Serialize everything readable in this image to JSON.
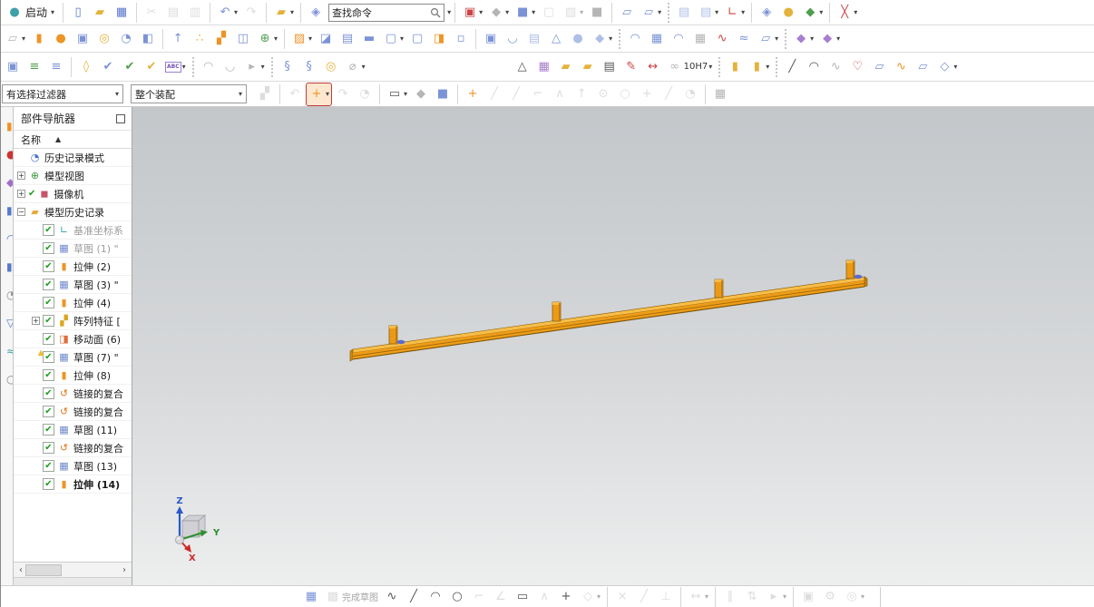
{
  "menubar": {
    "start_label": "启动",
    "caret": "▾"
  },
  "search": {
    "value": "查找命令"
  },
  "selection_bar": {
    "filter_value": "有选择过滤器",
    "scope_value": "整个装配"
  },
  "navigator": {
    "title": "部件导航器",
    "name_header": "名称",
    "sort_icon": "▲",
    "items": [
      {
        "label": "历史记录模式",
        "icon": "clock"
      },
      {
        "label": "模型视图",
        "icon": "views",
        "exp": "+"
      },
      {
        "label": "摄像机",
        "icon": "camera",
        "exp": "+",
        "pre": true
      },
      {
        "label": "模型历史记录",
        "icon": "folder",
        "exp": "-"
      },
      {
        "label": "基准坐标系",
        "icon": "csys",
        "check": true,
        "gray": true
      },
      {
        "label": "草图 (1) \"",
        "icon": "sketch",
        "check": true,
        "gray": true
      },
      {
        "label": "拉伸 (2)",
        "icon": "extrude",
        "check": true
      },
      {
        "label": "草图 (3) \"",
        "icon": "sketch",
        "check": true
      },
      {
        "label": "拉伸 (4)",
        "icon": "extrude",
        "check": true
      },
      {
        "label": "阵列特征 [",
        "icon": "pattern",
        "check": true,
        "exp": "+"
      },
      {
        "label": "移动面 (6)",
        "icon": "moveface",
        "check": true
      },
      {
        "label": "草图 (7) \"",
        "icon": "sketch",
        "check": true,
        "warn": true
      },
      {
        "label": "拉伸 (8)",
        "icon": "extrude",
        "check": true
      },
      {
        "label": "链接的复合",
        "icon": "linked",
        "check": true
      },
      {
        "label": "链接的复合",
        "icon": "linked",
        "check": true
      },
      {
        "label": "草图 (11)",
        "icon": "sketch",
        "check": true
      },
      {
        "label": "链接的复合",
        "icon": "linked",
        "check": true
      },
      {
        "label": "草图 (13)",
        "icon": "sketch",
        "check": true
      },
      {
        "label": "拉伸 (14)",
        "icon": "extrude",
        "check": true,
        "bold": true
      }
    ],
    "scroll_left": "‹",
    "scroll_right": "›"
  },
  "viewport": {
    "axis_x": "X",
    "axis_y": "Y",
    "axis_z": "Z",
    "model_color": "#ee9c18",
    "model_top_color": "#f8be49",
    "model_edge_color": "#7a5408"
  },
  "toolbar_row1a": [
    {
      "sep": 1
    },
    {
      "n": "new-file-button",
      "g": "▯",
      "c": "c-save"
    },
    {
      "n": "open-button",
      "g": "▰",
      "c": "c-gold"
    },
    {
      "n": "save-button",
      "g": "▦",
      "c": "c-save"
    },
    {
      "sep": 1
    },
    {
      "n": "cut-button",
      "g": "✂",
      "c": "c-gray",
      "dis": 1
    },
    {
      "n": "copy-button",
      "g": "▤",
      "c": "c-gray",
      "dis": 1
    },
    {
      "n": "paste-button",
      "g": "▥",
      "c": "c-gray",
      "dis": 1
    },
    {
      "sep": 1
    },
    {
      "n": "undo-button",
      "g": "↶",
      "c": "c-blue",
      "cap": 1
    },
    {
      "n": "redo-button",
      "g": "↷",
      "c": "c-gray",
      "dis": 1
    },
    {
      "sep": 1
    },
    {
      "n": "reopen-part-button",
      "g": "▰",
      "c": "c-gold",
      "cap": 1
    },
    {
      "sep": 1
    },
    {
      "n": "command-help-button",
      "g": "◈",
      "c": "c-blue"
    }
  ],
  "toolbar_row1b": [
    {
      "sep": 1
    },
    {
      "n": "fit-view-button",
      "g": "▣",
      "c": "c-red",
      "cap": 1
    },
    {
      "n": "render-style-button",
      "g": "◆",
      "c": "c-gray",
      "cap": 1
    },
    {
      "n": "orient-view-button",
      "g": "■",
      "c": "c-blue",
      "cap": 1
    },
    {
      "n": "section-view-button",
      "g": "▢",
      "c": "c-gray",
      "dis": 1
    },
    {
      "n": "drafting-view-button",
      "g": "▧",
      "c": "c-gray",
      "dis": 1,
      "cap": 1
    },
    {
      "n": "window-style-button",
      "g": "■",
      "c": "c-gray"
    },
    {
      "sep": 1
    },
    {
      "n": "new-window-button",
      "g": "▱",
      "c": "c-blue"
    },
    {
      "n": "cascade-windows-button",
      "g": "▱",
      "c": "c-blue",
      "cap": 1
    },
    {
      "sep": 1,
      "dot": 1
    },
    {
      "n": "part-navigator-list-button",
      "g": "▤",
      "c": "c-lblue"
    },
    {
      "n": "assembly-navigator-list-button",
      "g": "▤",
      "c": "c-lblue",
      "cap": 1
    },
    {
      "n": "wcs-dynamics-button",
      "g": "∟",
      "c": "c-red",
      "cap": 1
    },
    {
      "sep": 1
    },
    {
      "n": "help-library-button",
      "g": "◈",
      "c": "c-blue"
    },
    {
      "n": "touch-mode-button",
      "g": "●",
      "c": "c-gold"
    },
    {
      "n": "visual-reporting-button",
      "g": "◆",
      "c": "c-green",
      "cap": 1
    },
    {
      "sep": 1
    },
    {
      "n": "no-selection-filter-button",
      "g": "╳",
      "c": "c-red",
      "cap": 1
    }
  ],
  "toolbar_row2": [
    {
      "n": "sheet-operations-button",
      "g": "▱",
      "c": "c-gray",
      "cap": 1
    },
    {
      "n": "extrude-button",
      "g": "▮",
      "c": "c-orange"
    },
    {
      "n": "revolve-button",
      "g": "●",
      "c": "c-orange"
    },
    {
      "n": "hole-button",
      "g": "▣",
      "c": "c-blue"
    },
    {
      "n": "boss-button",
      "g": "◎",
      "c": "c-gold"
    },
    {
      "n": "pocket-button",
      "g": "◔",
      "c": "c-blue"
    },
    {
      "n": "pad-button",
      "g": "◧",
      "c": "c-blue"
    },
    {
      "sep": 1
    },
    {
      "n": "emboss-button",
      "g": "↑",
      "c": "c-blue"
    },
    {
      "n": "offset-face-button",
      "g": "∴",
      "c": "c-gold"
    },
    {
      "n": "pattern-feature-button",
      "g": "▞",
      "c": "c-orange"
    },
    {
      "n": "mirror-feature-button",
      "g": "◫",
      "c": "c-blue"
    },
    {
      "n": "unite-button",
      "g": "⊕",
      "c": "c-green",
      "cap": 1
    },
    {
      "sep": 1
    },
    {
      "n": "trim-body-button",
      "g": "▨",
      "c": "c-orange",
      "cap": 1
    },
    {
      "n": "subtract-button",
      "g": "◪",
      "c": "c-blue"
    },
    {
      "n": "delete-face-button",
      "g": "▤",
      "c": "c-blue"
    },
    {
      "n": "trim-sheet-button",
      "g": "▬",
      "c": "c-blue"
    },
    {
      "n": "split-body-button",
      "g": "▢",
      "c": "c-blue",
      "cap": 1
    },
    {
      "n": "cavity-button",
      "g": "▢",
      "c": "c-blue"
    },
    {
      "n": "thicken-button",
      "g": "◨",
      "c": "c-orange"
    },
    {
      "n": "scale-body-button",
      "g": "▫",
      "c": "c-blue"
    },
    {
      "sep": 1
    },
    {
      "n": "shell-button",
      "g": "▣",
      "c": "c-blue"
    },
    {
      "n": "bend-button",
      "g": "◡",
      "c": "c-blue"
    },
    {
      "n": "law-extension-button",
      "g": "▤",
      "c": "c-lblue"
    },
    {
      "n": "draft-button",
      "g": "△",
      "c": "c-blue"
    },
    {
      "n": "edge-blend-button",
      "g": "●",
      "c": "c-lblue"
    },
    {
      "n": "chamfer-button",
      "g": "◆",
      "c": "c-lblue",
      "cap": 1
    },
    {
      "sep": 1,
      "dot": 1
    },
    {
      "n": "ruled-surface-button",
      "g": "◠",
      "c": "c-blue"
    },
    {
      "n": "through-curves-button",
      "g": "▦",
      "c": "c-blue"
    },
    {
      "n": "swept-button",
      "g": "◠",
      "c": "c-blue"
    },
    {
      "n": "mesh-surface-button",
      "g": "▦",
      "c": "c-gray"
    },
    {
      "n": "studio-surface-button",
      "g": "∿",
      "c": "c-red"
    },
    {
      "n": "through-curve-mesh-button",
      "g": "≈",
      "c": "c-blue"
    },
    {
      "n": "emboss-sheet-button",
      "g": "▱",
      "c": "c-blue",
      "cap": 1
    },
    {
      "sep": 1,
      "dot": 1
    },
    {
      "n": "move-object-button",
      "g": "◆",
      "c": "c-purple",
      "cap": 1
    },
    {
      "n": "deform-body-button",
      "g": "◆",
      "c": "c-purple",
      "cap": 1
    }
  ],
  "toolbar_row3": [
    {
      "n": "spline-frame-button",
      "g": "▣",
      "c": "c-blue"
    },
    {
      "n": "layer-settings-button",
      "g": "≡",
      "c": "c-green"
    },
    {
      "n": "layer-visibility-button",
      "g": "≡",
      "c": "c-blue"
    },
    {
      "sep": 1
    },
    {
      "n": "annotation-tag-button",
      "g": "◊",
      "c": "c-gold"
    },
    {
      "n": "replay-feature-button",
      "g": "✔",
      "c": "c-blue"
    },
    {
      "n": "examine-geometry-button",
      "g": "✔",
      "c": "c-green"
    },
    {
      "n": "feature-check-button",
      "g": "✔",
      "c": "c-gold"
    },
    {
      "n": "text-button",
      "g": "ABC",
      "c": "c-abc",
      "cap": 1
    },
    {
      "sep": 1,
      "dot": 1
    },
    {
      "n": "unsew-button",
      "g": "◠",
      "c": "c-gray"
    },
    {
      "n": "unsew-alt-button",
      "g": "◡",
      "c": "c-gray"
    },
    {
      "n": "selection-priority-button",
      "g": "▸",
      "c": "c-gray",
      "cap": 1
    },
    {
      "sep": 1,
      "dot": 1
    },
    {
      "n": "coil-button",
      "g": "§",
      "c": "c-blue"
    },
    {
      "n": "spring-button",
      "g": "§",
      "c": "c-blue"
    },
    {
      "n": "washer-button",
      "g": "◎",
      "c": "c-gold"
    },
    {
      "n": "suppress-spring-button",
      "g": "⌀",
      "c": "c-gray",
      "cap": 1
    },
    {
      "sep": 1,
      "gap": 1
    },
    {
      "n": "triangle-symbol-button",
      "g": "△",
      "c": "c-dark"
    },
    {
      "n": "tabular-note-button",
      "g": "▦",
      "c": "c-purple"
    },
    {
      "n": "point-set-button",
      "g": "▰",
      "c": "c-gold"
    },
    {
      "n": "group-features-button",
      "g": "▰",
      "c": "c-gold"
    },
    {
      "n": "note-editor-button",
      "g": "▤",
      "c": "c-dark"
    },
    {
      "n": "style-brush-button",
      "g": "✎",
      "c": "c-red"
    },
    {
      "n": "dimension-button",
      "g": "↔",
      "c": "c-red"
    },
    {
      "n": "limits-fits-button",
      "g": "∞",
      "c": "c-gray",
      "txt": "10H7",
      "cap": 1
    },
    {
      "sep": 1,
      "dot": 1
    },
    {
      "n": "lock-button",
      "g": "▮",
      "c": "c-gold"
    },
    {
      "n": "unlock-button",
      "g": "▮",
      "c": "c-gold",
      "cap": 1
    },
    {
      "sep": 1,
      "dot": 1
    },
    {
      "n": "line-button",
      "g": "╱",
      "c": "c-dark"
    },
    {
      "n": "arc-button",
      "g": "◠",
      "c": "c-dark"
    },
    {
      "n": "studio-spline-button",
      "g": "∿",
      "c": "c-gray"
    },
    {
      "n": "section-curve-button",
      "g": "♡",
      "c": "c-red"
    },
    {
      "n": "project-curve-button",
      "g": "▱",
      "c": "c-blue"
    },
    {
      "n": "intersection-curve-button",
      "g": "∿",
      "c": "c-orange"
    },
    {
      "n": "isoparametric-curve-button",
      "g": "▱",
      "c": "c-blue"
    },
    {
      "n": "mirror-curve-button",
      "g": "◇",
      "c": "c-blue",
      "cap": 1
    }
  ],
  "toolbar_row4": [
    {
      "n": "assembly-constraints-button",
      "g": "▞",
      "c": "c-gray",
      "dis": 1
    },
    {
      "sep": 1
    },
    {
      "n": "filter-undo-button",
      "g": "↶",
      "c": "c-gray",
      "dis": 1
    },
    {
      "n": "add-to-filter-button",
      "g": "+",
      "c": "c-orange",
      "hl": 1,
      "cap": 1
    },
    {
      "n": "reset-filter-button",
      "g": "↷",
      "c": "c-gray",
      "dis": 1
    },
    {
      "n": "pick-filter-button",
      "g": "◔",
      "c": "c-gray",
      "dis": 1
    },
    {
      "sep": 1
    },
    {
      "n": "marquee-select-button",
      "g": "▭",
      "c": "c-dark",
      "cap": 1
    },
    {
      "n": "highlight-shaded-button",
      "g": "◆",
      "c": "c-gray"
    },
    {
      "n": "clip-section-button",
      "g": "■",
      "c": "c-blue"
    },
    {
      "sep": 1
    },
    {
      "n": "enable-snap-point-button",
      "g": "+",
      "c": "c-orange"
    },
    {
      "n": "snap-endpoint-button",
      "g": "╱",
      "c": "c-gray",
      "dis": 1
    },
    {
      "n": "snap-midpoint-button",
      "g": "╱",
      "c": "c-gray",
      "dis": 1
    },
    {
      "n": "snap-control-point-button",
      "g": "⌐",
      "c": "c-gray",
      "dis": 1
    },
    {
      "n": "snap-intersection-button",
      "g": "∧",
      "c": "c-gray",
      "dis": 1
    },
    {
      "n": "snap-arc-center-button",
      "g": "↑",
      "c": "c-gray",
      "dis": 1
    },
    {
      "n": "snap-quadrant-button",
      "g": "⊙",
      "c": "c-gray",
      "dis": 1
    },
    {
      "n": "snap-existing-point-button",
      "g": "○",
      "c": "c-gray",
      "dis": 1
    },
    {
      "n": "snap-point-on-curve-button",
      "g": "+",
      "c": "c-gray",
      "dis": 1
    },
    {
      "n": "snap-point-on-surface-button",
      "g": "╱",
      "c": "c-gray",
      "dis": 1
    },
    {
      "n": "snap-bounded-grid-button",
      "g": "◔",
      "c": "c-gray",
      "dis": 1
    },
    {
      "sep": 1
    },
    {
      "n": "grid-button",
      "g": "▦",
      "c": "c-gray"
    }
  ],
  "bottom_row": [
    {
      "n": "sketch-task-button",
      "g": "▦",
      "c": "c-blue"
    },
    {
      "n": "finish-sketch-button",
      "g": "▩",
      "c": "c-gray",
      "dis": 1,
      "txt": "完成草图"
    },
    {
      "n": "profile-button",
      "g": "∿",
      "c": "c-dark"
    },
    {
      "n": "line-tool-button",
      "g": "╱",
      "c": "c-dark"
    },
    {
      "n": "arc-tool-button",
      "g": "◠",
      "c": "c-dark"
    },
    {
      "n": "circle-tool-button",
      "g": "○",
      "c": "c-dark"
    },
    {
      "n": "fillet-tool-button",
      "g": "⌐",
      "c": "c-gray",
      "dis": 1
    },
    {
      "n": "chamfer-tool-button",
      "g": "∠",
      "c": "c-gray",
      "dis": 1
    },
    {
      "n": "rectangle-tool-button",
      "g": "▭",
      "c": "c-dark"
    },
    {
      "n": "polygon-tool-button",
      "g": "∧",
      "c": "c-gray",
      "dis": 1
    },
    {
      "n": "point-tool-button",
      "g": "+",
      "c": "c-dark"
    },
    {
      "n": "pattern-curve-button",
      "g": "◇",
      "c": "c-gray",
      "dis": 1,
      "cap": 1
    },
    {
      "sep": 1
    },
    {
      "n": "quick-trim-button",
      "g": "×",
      "c": "c-gray",
      "dis": 1
    },
    {
      "n": "quick-extend-button",
      "g": "╱",
      "c": "c-gray",
      "dis": 1
    },
    {
      "n": "make-corner-button",
      "g": "⊥",
      "c": "c-gray",
      "dis": 1
    },
    {
      "sep": 1
    },
    {
      "n": "rapid-dimension-button",
      "g": "↔",
      "c": "c-gray",
      "dis": 1,
      "cap": 1
    },
    {
      "sep": 1
    },
    {
      "n": "geometric-constraints-button",
      "g": "∥",
      "c": "c-gray",
      "dis": 1
    },
    {
      "n": "auto-dimension-button",
      "g": "⇅",
      "c": "c-gray",
      "dis": 1
    },
    {
      "n": "display-constraints-button",
      "g": "▸",
      "c": "c-gray",
      "dis": 1,
      "cap": 1
    },
    {
      "sep": 1
    },
    {
      "n": "sketch-relations-button",
      "g": "▣",
      "c": "c-gray",
      "dis": 1
    },
    {
      "n": "reattach-sketch-button",
      "g": "⚙",
      "c": "c-gray",
      "dis": 1
    },
    {
      "n": "orient-sketch-button",
      "g": "◎",
      "c": "c-gray",
      "dis": 1,
      "cap": 1
    }
  ],
  "resource_strip": [
    {
      "n": "resource-bar-icon",
      "g": "▮",
      "color": "#ee9326"
    },
    {
      "n": "resource-bar-icon",
      "g": "●",
      "color": "#cc3333"
    },
    {
      "n": "resource-bar-icon",
      "g": "◆",
      "color": "#a070c8"
    },
    {
      "n": "resource-bar-icon",
      "g": "▮",
      "color": "#5577cc"
    },
    {
      "n": "resource-bar-icon",
      "g": "◠",
      "color": "#5577cc"
    },
    {
      "n": "resource-bar-icon",
      "g": "▮",
      "color": "#5577cc"
    },
    {
      "n": "resource-bar-icon",
      "g": "◔",
      "color": "#888888"
    },
    {
      "n": "resource-bar-icon",
      "g": "▽",
      "color": "#5577cc"
    },
    {
      "n": "resource-bar-icon",
      "g": "≈",
      "color": "#3fa0a8"
    },
    {
      "n": "resource-bar-icon",
      "g": "○",
      "color": "#888888"
    }
  ]
}
